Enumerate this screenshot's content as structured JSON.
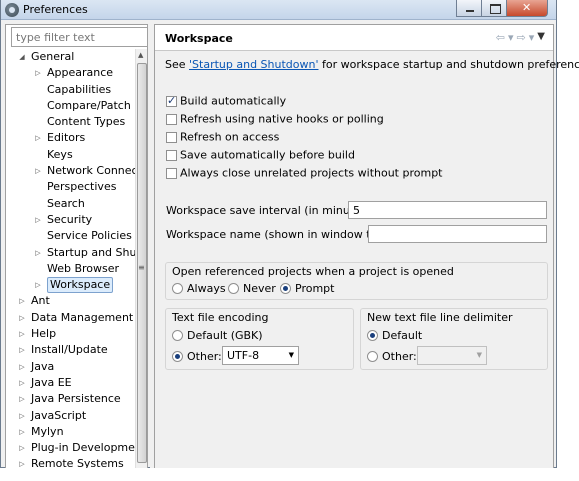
{
  "window": {
    "title": "Preferences",
    "minimize_icon": "minimize-icon",
    "maximize_icon": "maximize-icon",
    "close_icon": "close-icon"
  },
  "filter": {
    "placeholder": "type filter text"
  },
  "tree": [
    {
      "label": "General",
      "level": 0,
      "state": "expanded"
    },
    {
      "label": "Appearance",
      "level": 1,
      "state": "collapsed"
    },
    {
      "label": "Capabilities",
      "level": 1,
      "state": "leaf"
    },
    {
      "label": "Compare/Patch",
      "level": 1,
      "state": "leaf"
    },
    {
      "label": "Content Types",
      "level": 1,
      "state": "leaf"
    },
    {
      "label": "Editors",
      "level": 1,
      "state": "collapsed"
    },
    {
      "label": "Keys",
      "level": 1,
      "state": "leaf"
    },
    {
      "label": "Network Connecti",
      "level": 1,
      "state": "collapsed"
    },
    {
      "label": "Perspectives",
      "level": 1,
      "state": "leaf"
    },
    {
      "label": "Search",
      "level": 1,
      "state": "leaf"
    },
    {
      "label": "Security",
      "level": 1,
      "state": "collapsed"
    },
    {
      "label": "Service Policies",
      "level": 1,
      "state": "leaf"
    },
    {
      "label": "Startup and Shutd",
      "level": 1,
      "state": "collapsed"
    },
    {
      "label": "Web Browser",
      "level": 1,
      "state": "leaf"
    },
    {
      "label": "Workspace",
      "level": 1,
      "state": "collapsed",
      "selected": true
    },
    {
      "label": "Ant",
      "level": 0,
      "state": "collapsed"
    },
    {
      "label": "Data Management",
      "level": 0,
      "state": "collapsed"
    },
    {
      "label": "Help",
      "level": 0,
      "state": "collapsed"
    },
    {
      "label": "Install/Update",
      "level": 0,
      "state": "collapsed"
    },
    {
      "label": "Java",
      "level": 0,
      "state": "collapsed"
    },
    {
      "label": "Java EE",
      "level": 0,
      "state": "collapsed"
    },
    {
      "label": "Java Persistence",
      "level": 0,
      "state": "collapsed"
    },
    {
      "label": "JavaScript",
      "level": 0,
      "state": "collapsed"
    },
    {
      "label": "Mylyn",
      "level": 0,
      "state": "collapsed"
    },
    {
      "label": "Plug-in Development",
      "level": 0,
      "state": "collapsed"
    },
    {
      "label": "Remote Systems",
      "level": 0,
      "state": "collapsed"
    }
  ],
  "page": {
    "title": "Workspace",
    "nav": {
      "back_icon": "back-arrow-icon",
      "forward_icon": "forward-arrow-icon",
      "menu_icon": "view-menu-icon"
    },
    "intro_before": "See ",
    "intro_link": "'Startup and Shutdown'",
    "intro_after": " for workspace startup and shutdown preferences.",
    "checkboxes": [
      {
        "label": "Build automatically",
        "checked": true
      },
      {
        "label": "Refresh using native hooks or polling",
        "checked": false
      },
      {
        "label": "Refresh on access",
        "checked": false
      },
      {
        "label": "Save automatically before build",
        "checked": false
      },
      {
        "label": "Always close unrelated projects without prompt",
        "checked": false
      }
    ],
    "save_interval": {
      "label": "Workspace save interval (in minutes):",
      "value": "5"
    },
    "workspace_name": {
      "label": "Workspace name (shown in window title):",
      "value": ""
    },
    "open_projects": {
      "title": "Open referenced projects when a project is opened",
      "options": [
        {
          "label": "Always",
          "selected": false
        },
        {
          "label": "Never",
          "selected": false
        },
        {
          "label": "Prompt",
          "selected": true
        }
      ]
    },
    "encoding": {
      "title": "Text file encoding",
      "default_label": "Default (GBK)",
      "other_label": "Other:",
      "other_value": "UTF-8",
      "selected": "other"
    },
    "delimiter": {
      "title": "New text file line delimiter",
      "default_label": "Default",
      "other_label": "Other:",
      "other_value": "",
      "selected": "default"
    }
  }
}
